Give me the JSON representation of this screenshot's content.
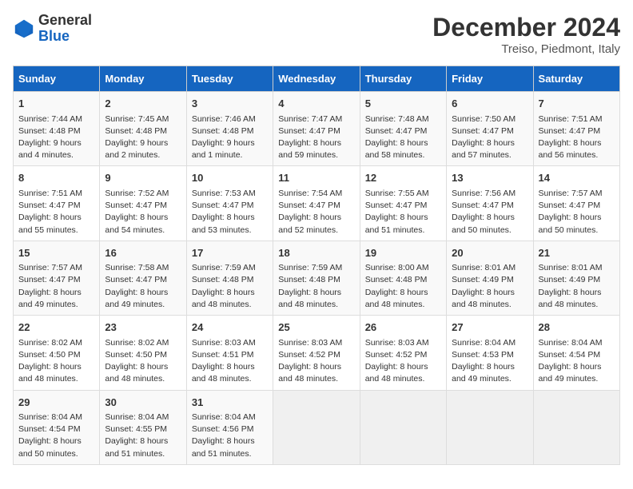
{
  "header": {
    "logo_general": "General",
    "logo_blue": "Blue",
    "month_title": "December 2024",
    "location": "Treiso, Piedmont, Italy"
  },
  "weekdays": [
    "Sunday",
    "Monday",
    "Tuesday",
    "Wednesday",
    "Thursday",
    "Friday",
    "Saturday"
  ],
  "weeks": [
    [
      {
        "day": 1,
        "lines": [
          "Sunrise: 7:44 AM",
          "Sunset: 4:48 PM",
          "Daylight: 9 hours",
          "and 4 minutes."
        ]
      },
      {
        "day": 2,
        "lines": [
          "Sunrise: 7:45 AM",
          "Sunset: 4:48 PM",
          "Daylight: 9 hours",
          "and 2 minutes."
        ]
      },
      {
        "day": 3,
        "lines": [
          "Sunrise: 7:46 AM",
          "Sunset: 4:48 PM",
          "Daylight: 9 hours",
          "and 1 minute."
        ]
      },
      {
        "day": 4,
        "lines": [
          "Sunrise: 7:47 AM",
          "Sunset: 4:47 PM",
          "Daylight: 8 hours",
          "and 59 minutes."
        ]
      },
      {
        "day": 5,
        "lines": [
          "Sunrise: 7:48 AM",
          "Sunset: 4:47 PM",
          "Daylight: 8 hours",
          "and 58 minutes."
        ]
      },
      {
        "day": 6,
        "lines": [
          "Sunrise: 7:50 AM",
          "Sunset: 4:47 PM",
          "Daylight: 8 hours",
          "and 57 minutes."
        ]
      },
      {
        "day": 7,
        "lines": [
          "Sunrise: 7:51 AM",
          "Sunset: 4:47 PM",
          "Daylight: 8 hours",
          "and 56 minutes."
        ]
      }
    ],
    [
      {
        "day": 8,
        "lines": [
          "Sunrise: 7:51 AM",
          "Sunset: 4:47 PM",
          "Daylight: 8 hours",
          "and 55 minutes."
        ]
      },
      {
        "day": 9,
        "lines": [
          "Sunrise: 7:52 AM",
          "Sunset: 4:47 PM",
          "Daylight: 8 hours",
          "and 54 minutes."
        ]
      },
      {
        "day": 10,
        "lines": [
          "Sunrise: 7:53 AM",
          "Sunset: 4:47 PM",
          "Daylight: 8 hours",
          "and 53 minutes."
        ]
      },
      {
        "day": 11,
        "lines": [
          "Sunrise: 7:54 AM",
          "Sunset: 4:47 PM",
          "Daylight: 8 hours",
          "and 52 minutes."
        ]
      },
      {
        "day": 12,
        "lines": [
          "Sunrise: 7:55 AM",
          "Sunset: 4:47 PM",
          "Daylight: 8 hours",
          "and 51 minutes."
        ]
      },
      {
        "day": 13,
        "lines": [
          "Sunrise: 7:56 AM",
          "Sunset: 4:47 PM",
          "Daylight: 8 hours",
          "and 50 minutes."
        ]
      },
      {
        "day": 14,
        "lines": [
          "Sunrise: 7:57 AM",
          "Sunset: 4:47 PM",
          "Daylight: 8 hours",
          "and 50 minutes."
        ]
      }
    ],
    [
      {
        "day": 15,
        "lines": [
          "Sunrise: 7:57 AM",
          "Sunset: 4:47 PM",
          "Daylight: 8 hours",
          "and 49 minutes."
        ]
      },
      {
        "day": 16,
        "lines": [
          "Sunrise: 7:58 AM",
          "Sunset: 4:47 PM",
          "Daylight: 8 hours",
          "and 49 minutes."
        ]
      },
      {
        "day": 17,
        "lines": [
          "Sunrise: 7:59 AM",
          "Sunset: 4:48 PM",
          "Daylight: 8 hours",
          "and 48 minutes."
        ]
      },
      {
        "day": 18,
        "lines": [
          "Sunrise: 7:59 AM",
          "Sunset: 4:48 PM",
          "Daylight: 8 hours",
          "and 48 minutes."
        ]
      },
      {
        "day": 19,
        "lines": [
          "Sunrise: 8:00 AM",
          "Sunset: 4:48 PM",
          "Daylight: 8 hours",
          "and 48 minutes."
        ]
      },
      {
        "day": 20,
        "lines": [
          "Sunrise: 8:01 AM",
          "Sunset: 4:49 PM",
          "Daylight: 8 hours",
          "and 48 minutes."
        ]
      },
      {
        "day": 21,
        "lines": [
          "Sunrise: 8:01 AM",
          "Sunset: 4:49 PM",
          "Daylight: 8 hours",
          "and 48 minutes."
        ]
      }
    ],
    [
      {
        "day": 22,
        "lines": [
          "Sunrise: 8:02 AM",
          "Sunset: 4:50 PM",
          "Daylight: 8 hours",
          "and 48 minutes."
        ]
      },
      {
        "day": 23,
        "lines": [
          "Sunrise: 8:02 AM",
          "Sunset: 4:50 PM",
          "Daylight: 8 hours",
          "and 48 minutes."
        ]
      },
      {
        "day": 24,
        "lines": [
          "Sunrise: 8:03 AM",
          "Sunset: 4:51 PM",
          "Daylight: 8 hours",
          "and 48 minutes."
        ]
      },
      {
        "day": 25,
        "lines": [
          "Sunrise: 8:03 AM",
          "Sunset: 4:52 PM",
          "Daylight: 8 hours",
          "and 48 minutes."
        ]
      },
      {
        "day": 26,
        "lines": [
          "Sunrise: 8:03 AM",
          "Sunset: 4:52 PM",
          "Daylight: 8 hours",
          "and 48 minutes."
        ]
      },
      {
        "day": 27,
        "lines": [
          "Sunrise: 8:04 AM",
          "Sunset: 4:53 PM",
          "Daylight: 8 hours",
          "and 49 minutes."
        ]
      },
      {
        "day": 28,
        "lines": [
          "Sunrise: 8:04 AM",
          "Sunset: 4:54 PM",
          "Daylight: 8 hours",
          "and 49 minutes."
        ]
      }
    ],
    [
      {
        "day": 29,
        "lines": [
          "Sunrise: 8:04 AM",
          "Sunset: 4:54 PM",
          "Daylight: 8 hours",
          "and 50 minutes."
        ]
      },
      {
        "day": 30,
        "lines": [
          "Sunrise: 8:04 AM",
          "Sunset: 4:55 PM",
          "Daylight: 8 hours",
          "and 51 minutes."
        ]
      },
      {
        "day": 31,
        "lines": [
          "Sunrise: 8:04 AM",
          "Sunset: 4:56 PM",
          "Daylight: 8 hours",
          "and 51 minutes."
        ]
      },
      null,
      null,
      null,
      null
    ]
  ]
}
